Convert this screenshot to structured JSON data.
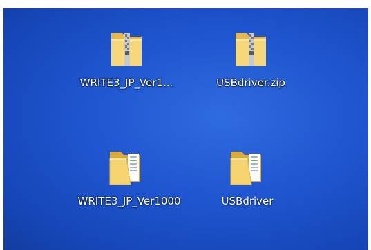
{
  "desktop": {
    "background": "#1f55cf",
    "icons": [
      {
        "label": "WRITE3_JP_Ver1...",
        "type": "zip-folder-icon"
      },
      {
        "label": "USBdriver.zip",
        "type": "zip-folder-icon"
      },
      {
        "label": "WRITE3_JP_Ver1000",
        "type": "folder-icon"
      },
      {
        "label": "USBdriver",
        "type": "folder-icon"
      }
    ]
  }
}
